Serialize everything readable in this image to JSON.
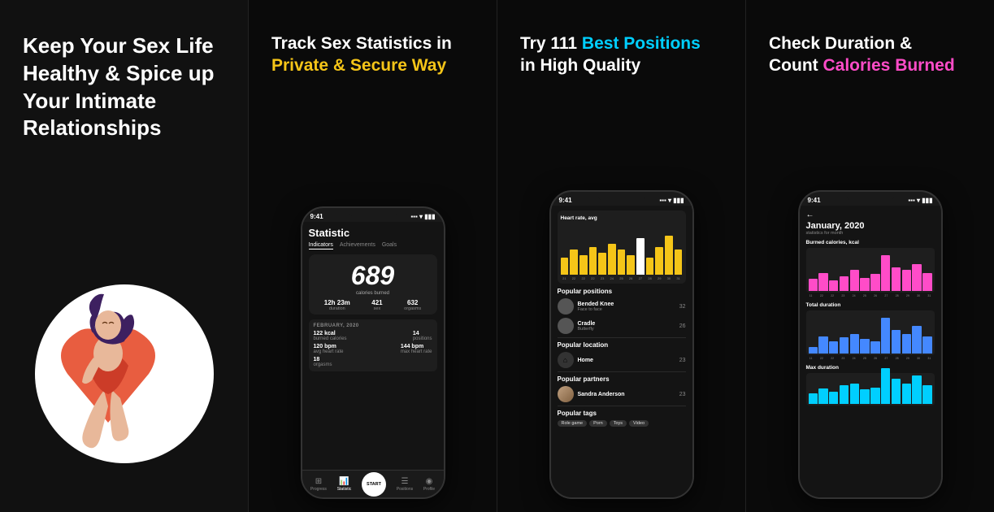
{
  "panel1": {
    "line1": "Keep Your Sex Life",
    "line2": "Healthy & Spice up",
    "line3": "Your Intimate",
    "line4": "Relationships"
  },
  "panel2": {
    "heading_normal": "Track Sex Statistics in",
    "heading_highlight": "Private & Secure Way",
    "phone": {
      "status_time": "9:41",
      "screen_title": "Statistic",
      "tab_indicators": "Indicators",
      "tab_achievements": "Achievements",
      "tab_goals": "Goals",
      "big_number": "689",
      "big_number_label": "calories burned",
      "duration_val": "12h 23m",
      "duration_lbl": "duration",
      "sex_val": "421",
      "sex_lbl": "sex",
      "orgasms_val": "632",
      "orgasms_lbl": "orgasms",
      "month_label": "FEBRUARY, 2020",
      "row1_val1": "122 kcal",
      "row1_lbl1": "burned calories",
      "row1_val2": "14",
      "row1_lbl2": "positions",
      "row2_val1": "120 bpm",
      "row2_lbl1": "avg heart rate",
      "row2_val2": "144 bpm",
      "row2_lbl2": "max heart rate",
      "row3_val1": "18",
      "row3_lbl1": "orgasms",
      "nav_progress": "Progress",
      "nav_statistic": "Statistic",
      "nav_start": "START",
      "nav_positions": "Positions",
      "nav_profile": "Profile"
    }
  },
  "panel3": {
    "heading_normal": "Try 111 ",
    "heading_highlight": "Best Positions",
    "heading_normal2": "in High Quality",
    "phone": {
      "status_time": "9:41",
      "chart_label": "Heart rate, avg",
      "positions_title": "Popular positions",
      "pos1_name": "Bended Knee",
      "pos1_sub": "Face to face",
      "pos1_count": "32",
      "pos2_name": "Cradle",
      "pos2_sub": "Butterfly",
      "pos2_count": "26",
      "location_title": "Popular location",
      "location_name": "Home",
      "location_count": "23",
      "partners_title": "Popular partners",
      "partner_name": "Sandra Anderson",
      "partner_count": "23",
      "tags_title": "Popular tags",
      "tag1": "Role game",
      "tag2": "Porn",
      "tag3": "Toys",
      "tag4": "Video",
      "dates": [
        "21",
        "22",
        "22",
        "22",
        "23",
        "24",
        "25",
        "26",
        "27",
        "28",
        "29",
        "30",
        "31"
      ],
      "bar_heights": [
        30,
        45,
        35,
        50,
        40,
        55,
        45,
        35,
        65,
        30,
        50,
        70,
        45
      ]
    }
  },
  "panel4": {
    "heading_line1": "Check Duration &",
    "heading_normal": "Count ",
    "heading_highlight": "Calories Burned",
    "phone": {
      "status_time": "9:41",
      "back_icon": "←",
      "month": "January, 2020",
      "subtitle": "statistics for month",
      "chart1_title": "Burned calories, kcal",
      "chart2_title": "Total duration",
      "chart3_title": "Max duration",
      "dates": [
        "11",
        "22",
        "22",
        "23",
        "24",
        "25",
        "26",
        "27",
        "28",
        "29",
        "30",
        "31"
      ],
      "pink_bars": [
        20,
        30,
        18,
        25,
        35,
        22,
        28,
        60,
        40,
        35,
        45,
        30
      ],
      "cyan_bars": [
        10,
        15,
        12,
        18,
        20,
        14,
        16,
        35,
        25,
        20,
        28,
        18
      ],
      "blue_bars": [
        8,
        22,
        15,
        20,
        25,
        18,
        15,
        45,
        30,
        25,
        35,
        22
      ]
    }
  }
}
